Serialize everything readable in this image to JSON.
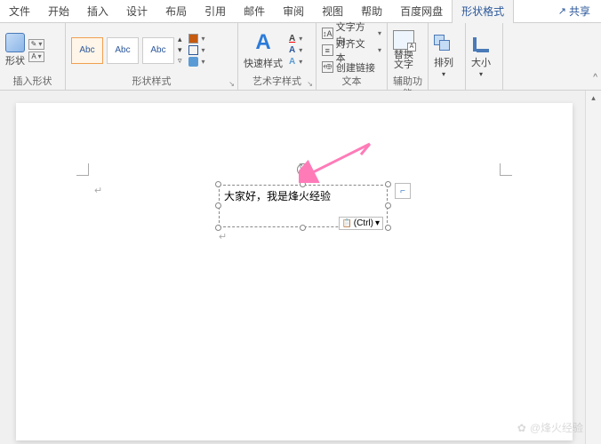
{
  "tabs": {
    "file": "文件",
    "home": "开始",
    "insert": "插入",
    "design": "设计",
    "layout": "布局",
    "references": "引用",
    "mailings": "邮件",
    "review": "审阅",
    "view": "视图",
    "help": "帮助",
    "baidu": "百度网盘",
    "shapeformat": "形状格式"
  },
  "share": "共享",
  "groups": {
    "insertshape": "插入形状",
    "shapestyle": "形状样式",
    "wordart": "艺术字样式",
    "text": "文本",
    "accessibility": "辅助功能",
    "shape_label": "形状",
    "quickstyle": "快速样式",
    "alttext": "替换\n文字",
    "arrange": "排列",
    "size": "大小"
  },
  "gallery": {
    "abc": "Abc"
  },
  "textmenu": {
    "direction": "文字方向",
    "align": "对齐文本",
    "link": "创建链接"
  },
  "textbox": {
    "content": "大家好，我是烽火经验",
    "pastetag": "(Ctrl)"
  },
  "watermark": "@烽火经验",
  "ruler_caret": "^"
}
